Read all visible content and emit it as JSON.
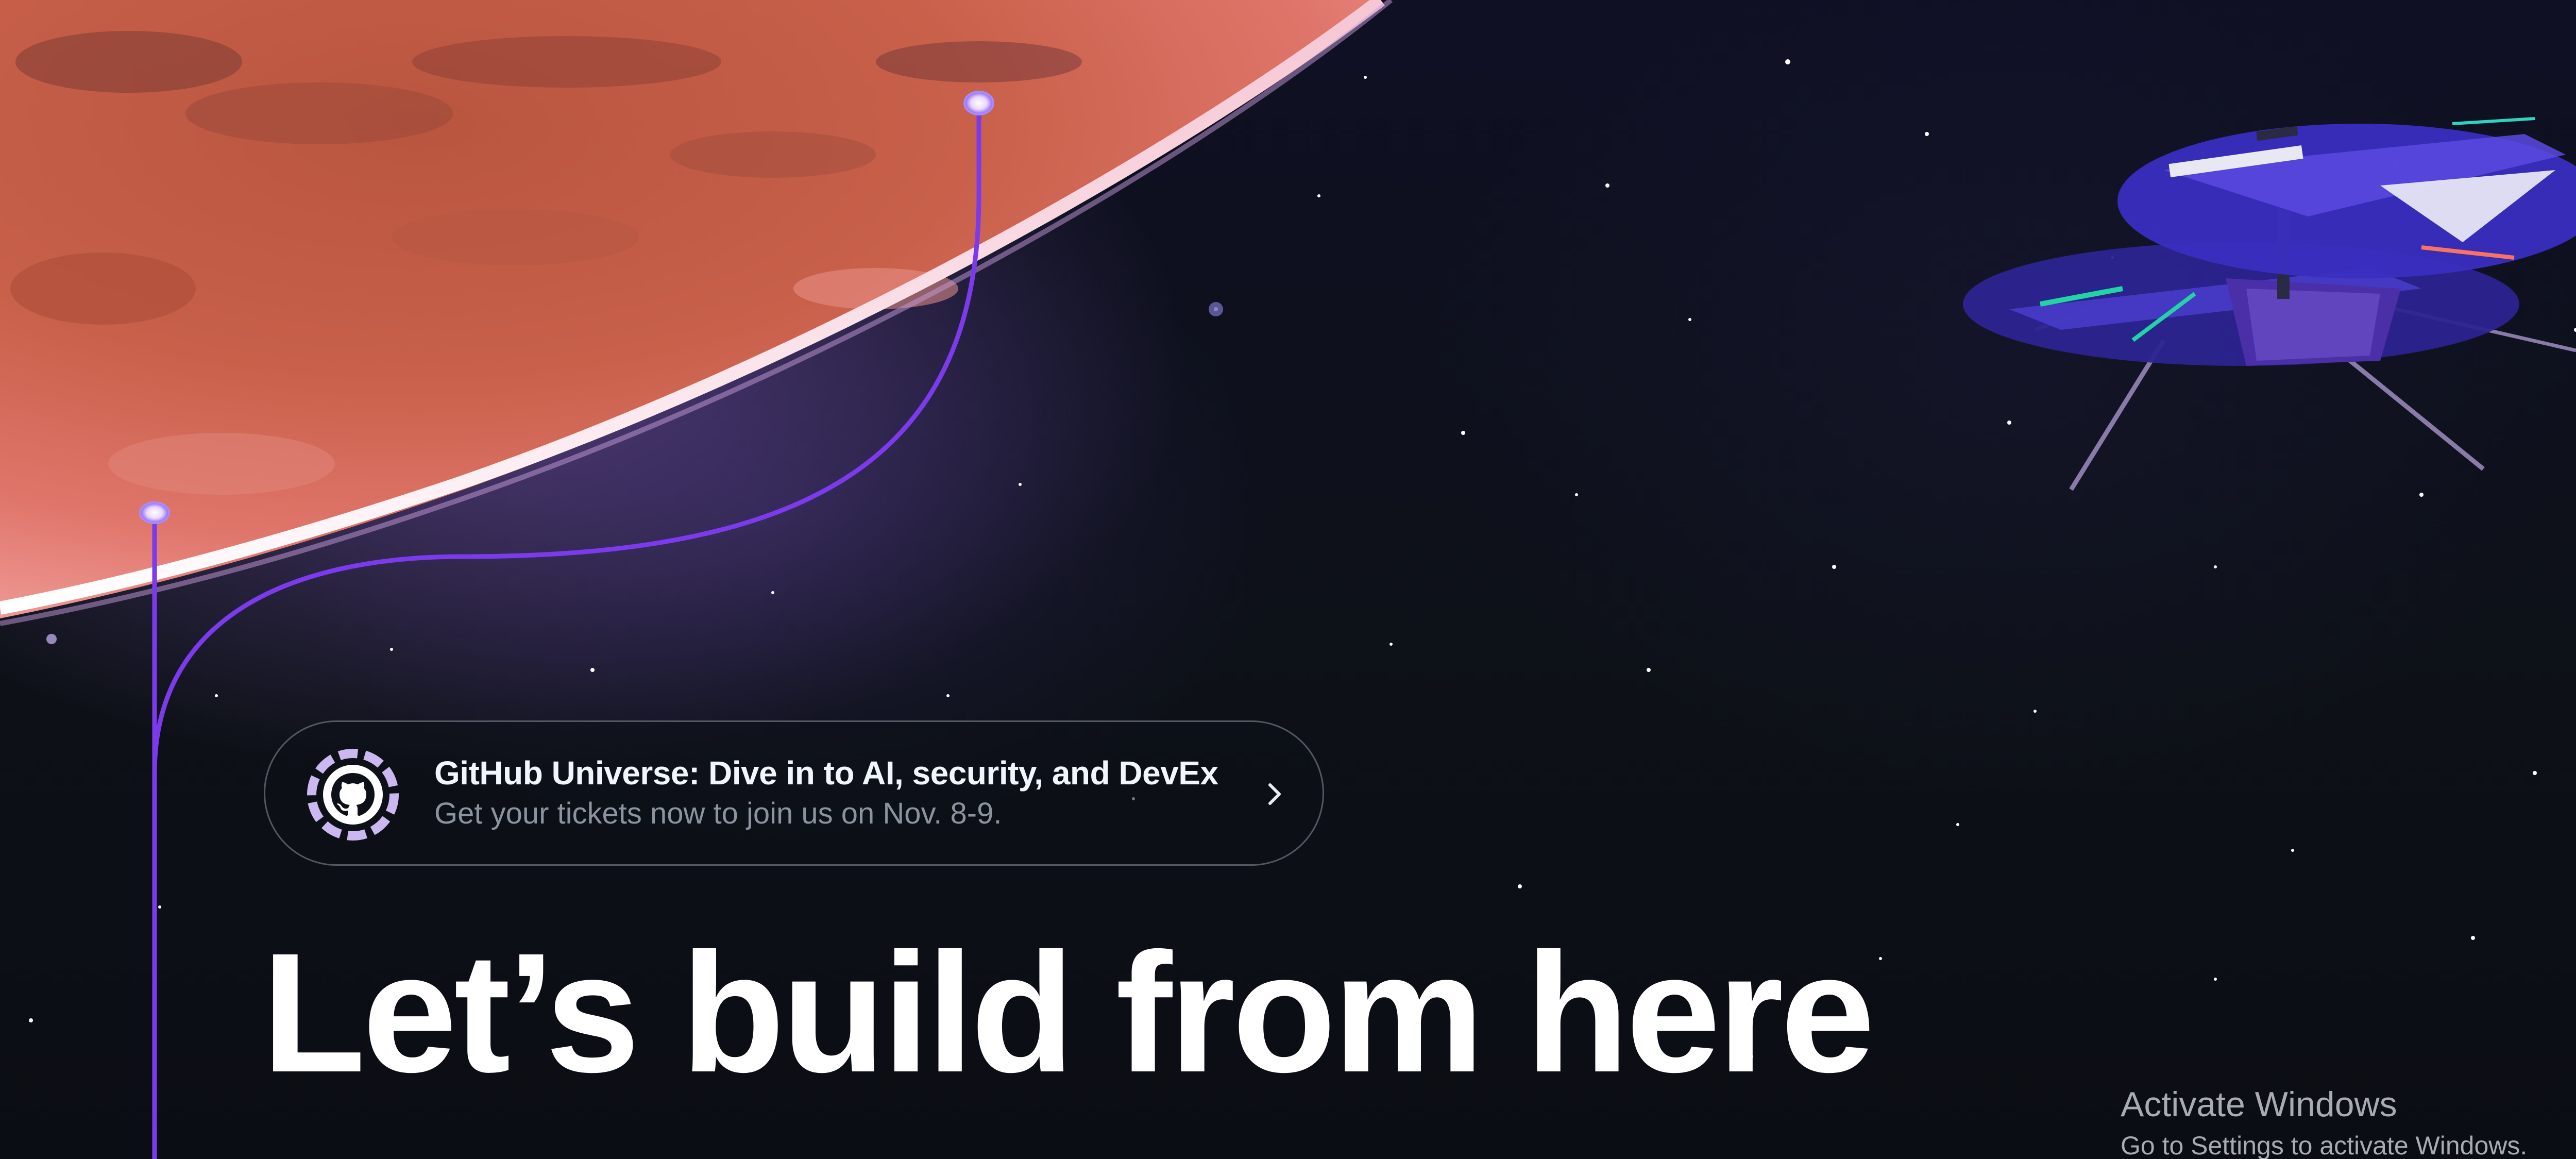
{
  "announcement": {
    "title": "GitHub Universe: Dive in to AI, security, and DevEx",
    "subtitle": "Get your tickets now to join us on Nov. 8-9.",
    "logo_icon": "github-universe-logo-icon",
    "chevron_icon": "chevron-right-icon"
  },
  "hero": {
    "title": "Let’s build from here"
  },
  "os_watermark": {
    "title": "Activate Windows",
    "subtitle": "Go to Settings to activate Windows."
  },
  "colors": {
    "background": "#0d1117",
    "timeline_line": "#7c3aed",
    "planet": "#d9684f",
    "helicopter": "#3b2ea8"
  }
}
